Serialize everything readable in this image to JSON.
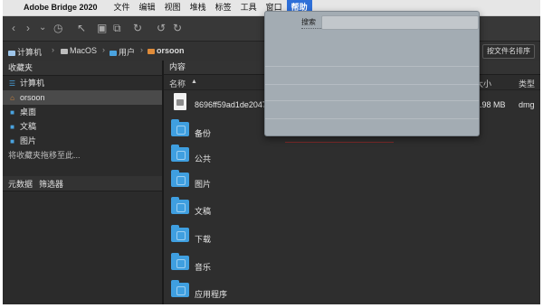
{
  "menubar": {
    "apple_glyph": "",
    "app_name": "Adobe Bridge 2020",
    "items": [
      "文件",
      "编辑",
      "视图",
      "堆栈",
      "标签",
      "工具",
      "窗口",
      "帮助"
    ],
    "active_item": "帮助"
  },
  "toolbar": {
    "icons": [
      "back-icon",
      "forward-icon",
      "dropdown-icon",
      "history-icon",
      "boomerang-icon",
      "camera-import-icon",
      "copy-icon",
      "refresh-icon",
      "undo-icon",
      "redo-icon"
    ],
    "glyphs": {
      "back": "‹",
      "forward": "›",
      "chevron": "⌄",
      "history": "◷",
      "boomerang": "↖",
      "camera": "▣",
      "copy": "⧉",
      "refresh": "↻",
      "undo": "↺",
      "redo": "↻"
    }
  },
  "pathbar": {
    "crumbs": [
      "计算机",
      "MacOS",
      "用户",
      "orsoon"
    ],
    "separator": "›",
    "search_button": "按文件名排序"
  },
  "favorites": {
    "title": "收藏夹",
    "items": [
      {
        "label": "计算机",
        "icon": "computer-icon"
      },
      {
        "label": "orsoon",
        "icon": "home-icon",
        "selected": true
      },
      {
        "label": "桌面",
        "icon": "folder-icon"
      },
      {
        "label": "文稿",
        "icon": "folder-icon"
      },
      {
        "label": "图片",
        "icon": "folder-icon"
      }
    ],
    "hint": "将收藏夹拖移至此..."
  },
  "bottom_tabs": [
    "元数据",
    "筛选器"
  ],
  "content": {
    "title": "内容",
    "columns": {
      "name": "名称",
      "sort_glyph": "▲",
      "size": "大小",
      "type": "类型"
    },
    "rows": [
      {
        "name": "8696ff59ad1de20471",
        "size": "1.98 MB",
        "type": "dmg",
        "icon": "disk-image-icon"
      },
      {
        "name": "备份",
        "size": "",
        "type": "",
        "icon": "folder-icon"
      },
      {
        "name": "公共",
        "size": "",
        "type": "",
        "icon": "folder-icon"
      },
      {
        "name": "图片",
        "size": "",
        "type": "",
        "icon": "folder-icon"
      },
      {
        "name": "文稿",
        "size": "",
        "type": "",
        "icon": "folder-icon"
      },
      {
        "name": "下载",
        "size": "",
        "type": "",
        "icon": "folder-icon"
      },
      {
        "name": "音乐",
        "size": "",
        "type": "",
        "icon": "folder-icon"
      },
      {
        "name": "应用程序",
        "size": "",
        "type": "",
        "icon": "folder-icon"
      }
    ]
  },
  "help_menu": {
    "search_label": "搜索",
    "search_value": ""
  },
  "colors": {
    "menu_highlight": "#2e6fd8",
    "folder_blue": "#3f9fe0",
    "panel_dark": "#2b2b2b"
  }
}
